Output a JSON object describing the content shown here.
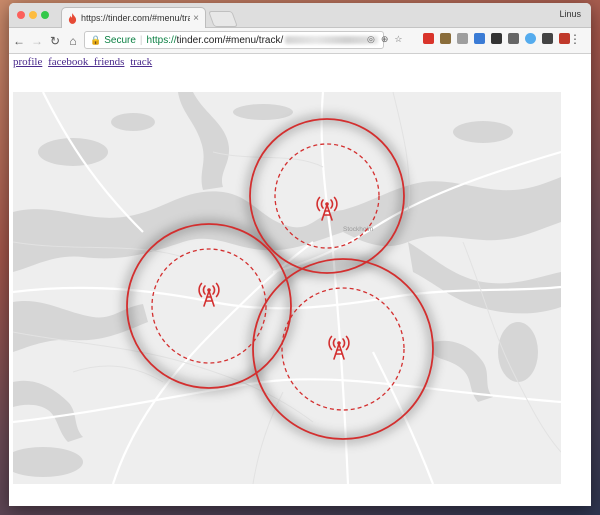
{
  "browser": {
    "tab_title": "https://tinder.com/#menu/track",
    "tab_close": "×",
    "profile_name": "Linus",
    "address": {
      "secure_label": "Secure",
      "url_scheme": "https://",
      "url_path": "tinder.com/#menu/track/"
    },
    "nav": {
      "back": "←",
      "forward": "→",
      "reload": "↻",
      "home": "⌂"
    },
    "menu": "⋮"
  },
  "page": {
    "links": [
      "profile",
      "facebook_friends",
      "track"
    ]
  },
  "map": {
    "place_label": "Stockholm",
    "ring_color": "#d32f2f",
    "tower_icon": "cell-tower-icon",
    "towers": 3
  },
  "colors": {
    "link": "#4a2a8c",
    "secure_green": "#0b8043",
    "water": "#d6d6d6",
    "land": "#eeeeee"
  }
}
